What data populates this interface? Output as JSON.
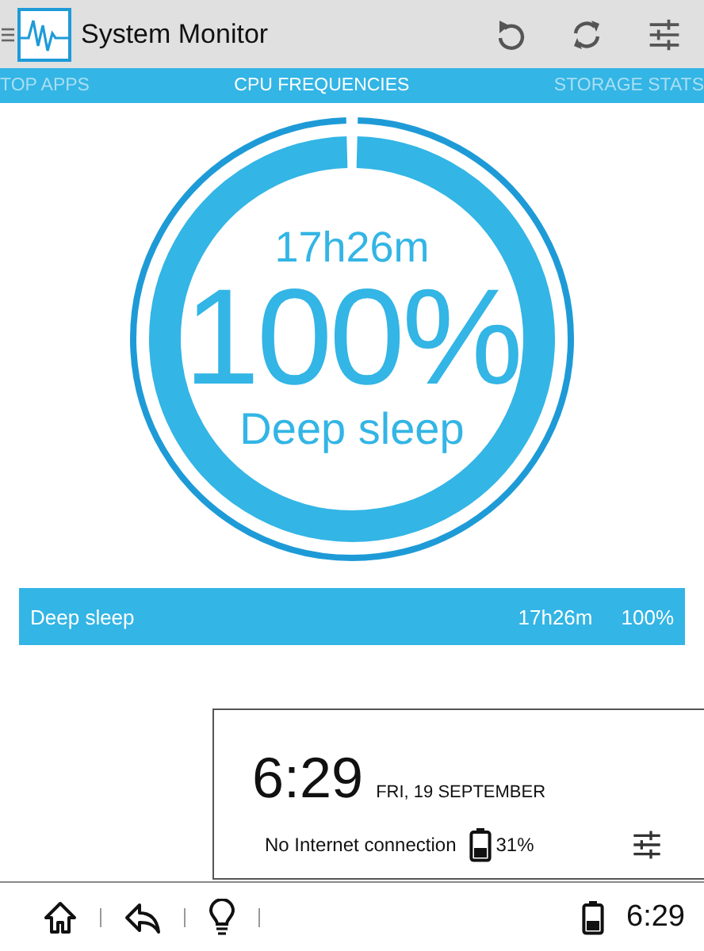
{
  "window": {
    "title": "System Monitor"
  },
  "tabs": [
    {
      "label": "TOP APPS",
      "selected": false
    },
    {
      "label": "CPU FREQUENCIES",
      "selected": true
    },
    {
      "label": "STORAGE STATS",
      "selected": false
    }
  ],
  "gauge": {
    "duration": "17h26m",
    "percent": "100%",
    "state": "Deep sleep"
  },
  "rows": [
    {
      "name": "Deep sleep",
      "duration": "17h26m",
      "percent": "100%"
    }
  ],
  "notification": {
    "time": "6:29",
    "date": "FRI, 19 SEPTEMBER",
    "network": "No Internet connection",
    "battery": "31%"
  },
  "status_bar": {
    "time": "6:29"
  }
}
